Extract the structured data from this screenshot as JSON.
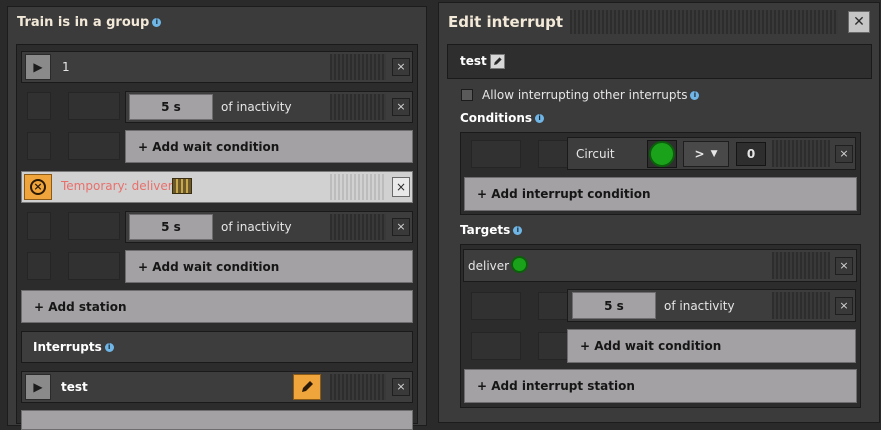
{
  "left": {
    "title": "Train is in a group",
    "station1": {
      "name": "1",
      "wait_value": "5 s",
      "wait_suffix": "of inactivity",
      "add_wait": "+ Add wait condition"
    },
    "temporary": {
      "label": "Temporary: deliver",
      "wait_value": "5 s",
      "wait_suffix": "of inactivity",
      "add_wait": "+ Add wait condition"
    },
    "add_station": "+ Add station",
    "interrupts_label": "Interrupts",
    "interrupt_name": "test",
    "close_glyph": "×",
    "play_glyph": "▶",
    "info_glyph": "i"
  },
  "right": {
    "title": "Edit interrupt",
    "close_glyph": "✕",
    "interrupt_name": "test",
    "allow_label": "Allow interrupting other interrupts",
    "conditions_label": "Conditions",
    "condition": {
      "signal": "Circuit",
      "operator": ">",
      "value": "0"
    },
    "add_interrupt_condition": "+ Add interrupt condition",
    "targets_label": "Targets",
    "target_name": "deliver",
    "target_wait_value": "5 s",
    "target_wait_suffix": "of inactivity",
    "add_wait": "+ Add wait condition",
    "add_interrupt_station": "+ Add interrupt station"
  },
  "colors": {
    "accent": "#f0a53c",
    "circuit": "#1aa31a",
    "temporary_text": "#e8706b"
  }
}
